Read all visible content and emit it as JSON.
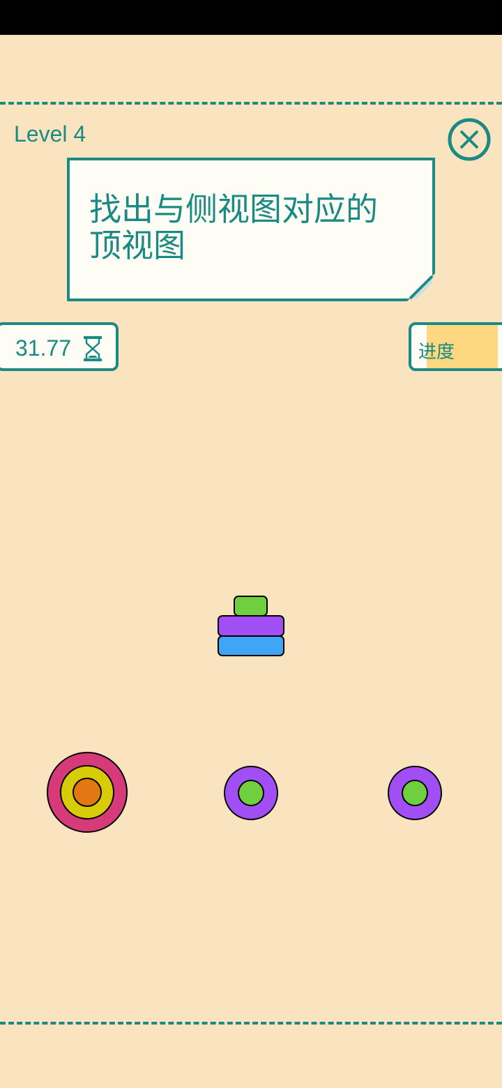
{
  "header": {
    "level_label": "Level 4"
  },
  "instruction": {
    "line1": "找出与侧视图对应的",
    "line2": "顶视图"
  },
  "timer": {
    "value": "31.77",
    "icon": "hourglass-icon"
  },
  "progress": {
    "label": "进度",
    "fraction": 0.85
  },
  "side_view": {
    "layers_top_to_bottom": [
      "green",
      "purple",
      "blue"
    ]
  },
  "options": [
    {
      "rings_outer_to_inner": [
        "pink",
        "yellow",
        "orange"
      ]
    },
    {
      "rings_outer_to_inner": [
        "purple",
        "green"
      ]
    },
    {
      "rings_outer_to_inner": [
        "purple",
        "green"
      ]
    }
  ],
  "colors": {
    "background": "#fae4c0",
    "accent": "#1a8a82",
    "card": "#fdfcf5",
    "progress_fill": "#fdd880",
    "green": "#6fcf3f",
    "purple": "#a24ef5",
    "blue": "#3fa6f5",
    "pink": "#d63a78",
    "yellow": "#d8cc08",
    "orange": "#e27812"
  }
}
